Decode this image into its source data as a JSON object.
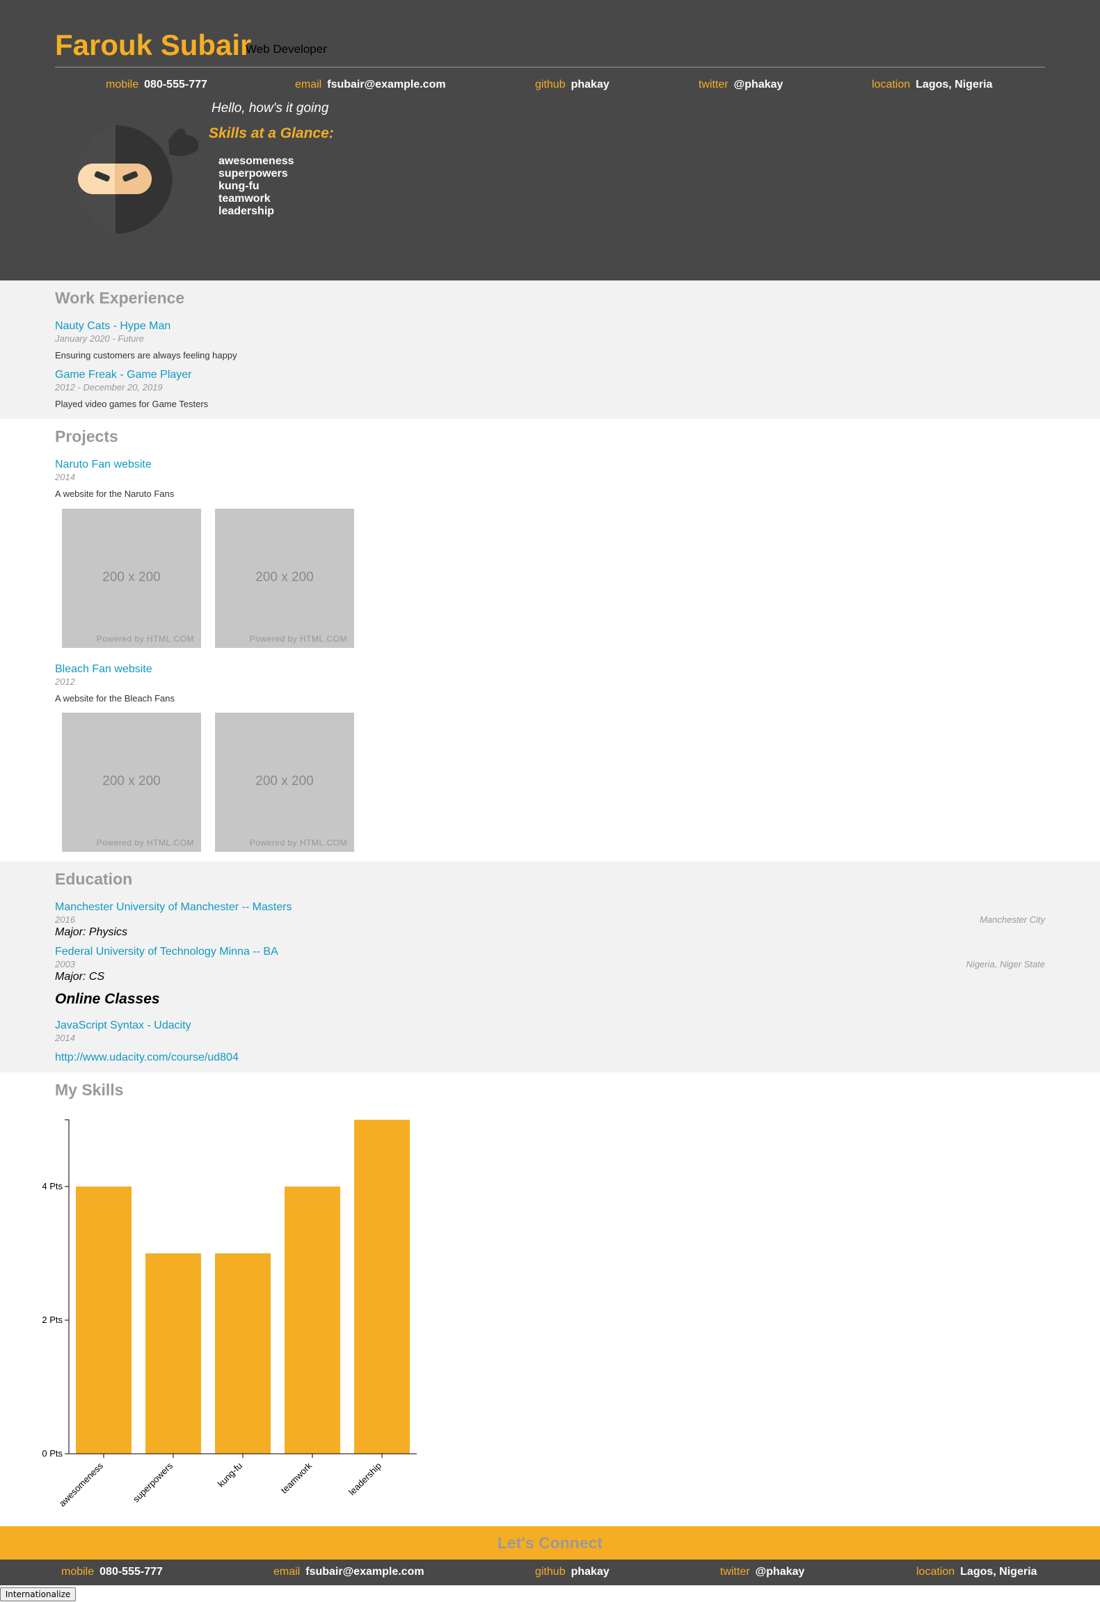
{
  "header": {
    "name": "Farouk Subair",
    "role": "Web Developer",
    "contacts": [
      {
        "label": "mobile",
        "value": "080-555-777"
      },
      {
        "label": "email",
        "value": "fsubair@example.com"
      },
      {
        "label": "github",
        "value": "phakay"
      },
      {
        "label": "twitter",
        "value": "@phakay"
      },
      {
        "label": "location",
        "value": "Lagos, Nigeria"
      }
    ],
    "welcome_message": "Hello, how's it going",
    "skills_heading": "Skills at a Glance:",
    "skills": [
      "awesomeness",
      "superpowers",
      "kung-fu",
      "teamwork",
      "leadership"
    ]
  },
  "work": {
    "title": "Work Experience",
    "jobs": [
      {
        "title": "Nauty Cats - Hype Man",
        "dates": "January 2020 - Future",
        "description": "Ensuring customers are always feeling happy"
      },
      {
        "title": "Game Freak - Game Player",
        "dates": "2012 - December 20, 2019",
        "description": "Played video games for Game Testers"
      }
    ]
  },
  "projects": {
    "title": "Projects",
    "items": [
      {
        "title": "Naruto Fan website",
        "dates": "2014",
        "description": "A website for the Naruto Fans",
        "images": [
          {
            "dims": "200 x 200",
            "credit": "Powered by HTML.COM"
          },
          {
            "dims": "200 x 200",
            "credit": "Powered by HTML.COM"
          }
        ]
      },
      {
        "title": "Bleach Fan website",
        "dates": "2012",
        "description": "A website for the Bleach Fans",
        "images": [
          {
            "dims": "200 x 200",
            "credit": "Powered by HTML.COM"
          },
          {
            "dims": "200 x 200",
            "credit": "Powered by HTML.COM"
          }
        ]
      }
    ]
  },
  "education": {
    "title": "Education",
    "schools": [
      {
        "title": "Manchester University of Manchester -- Masters",
        "dates": "2016",
        "location": "Manchester City",
        "major": "Major: Physics"
      },
      {
        "title": "Federal University of Technology Minna -- BA",
        "dates": "2003",
        "location": "Nigeria, Niger State",
        "major": "Major: CS"
      }
    ],
    "online_title": "Online Classes",
    "online": [
      {
        "title": "JavaScript Syntax - Udacity",
        "dates": "2014",
        "url": "http://www.udacity.com/course/ud804"
      }
    ]
  },
  "skills_chart": {
    "title": "My Skills"
  },
  "chart_data": {
    "type": "bar",
    "categories": [
      "awesomeness",
      "superpowers",
      "kung-fu",
      "teamwork",
      "leadership"
    ],
    "values": [
      4,
      3,
      3,
      4,
      5
    ],
    "yticks": [
      0,
      2,
      4
    ],
    "ytick_labels": [
      "0 Pts",
      "2 Pts",
      "4 Pts"
    ],
    "ylim": [
      0,
      5
    ],
    "color": "#f5ae23",
    "grid": false
  },
  "connect": {
    "title": "Let's Connect"
  },
  "footer": {
    "contacts": [
      {
        "label": "mobile",
        "value": "080-555-777"
      },
      {
        "label": "email",
        "value": "fsubair@example.com"
      },
      {
        "label": "github",
        "value": "phakay"
      },
      {
        "label": "twitter",
        "value": "@phakay"
      },
      {
        "label": "location",
        "value": "Lagos, Nigeria"
      }
    ]
  },
  "internationalize_label": "Internationalize",
  "colors": {
    "accent": "#f5ae23",
    "header_bg": "#484848",
    "link": "#1199c4",
    "muted": "#999999"
  }
}
